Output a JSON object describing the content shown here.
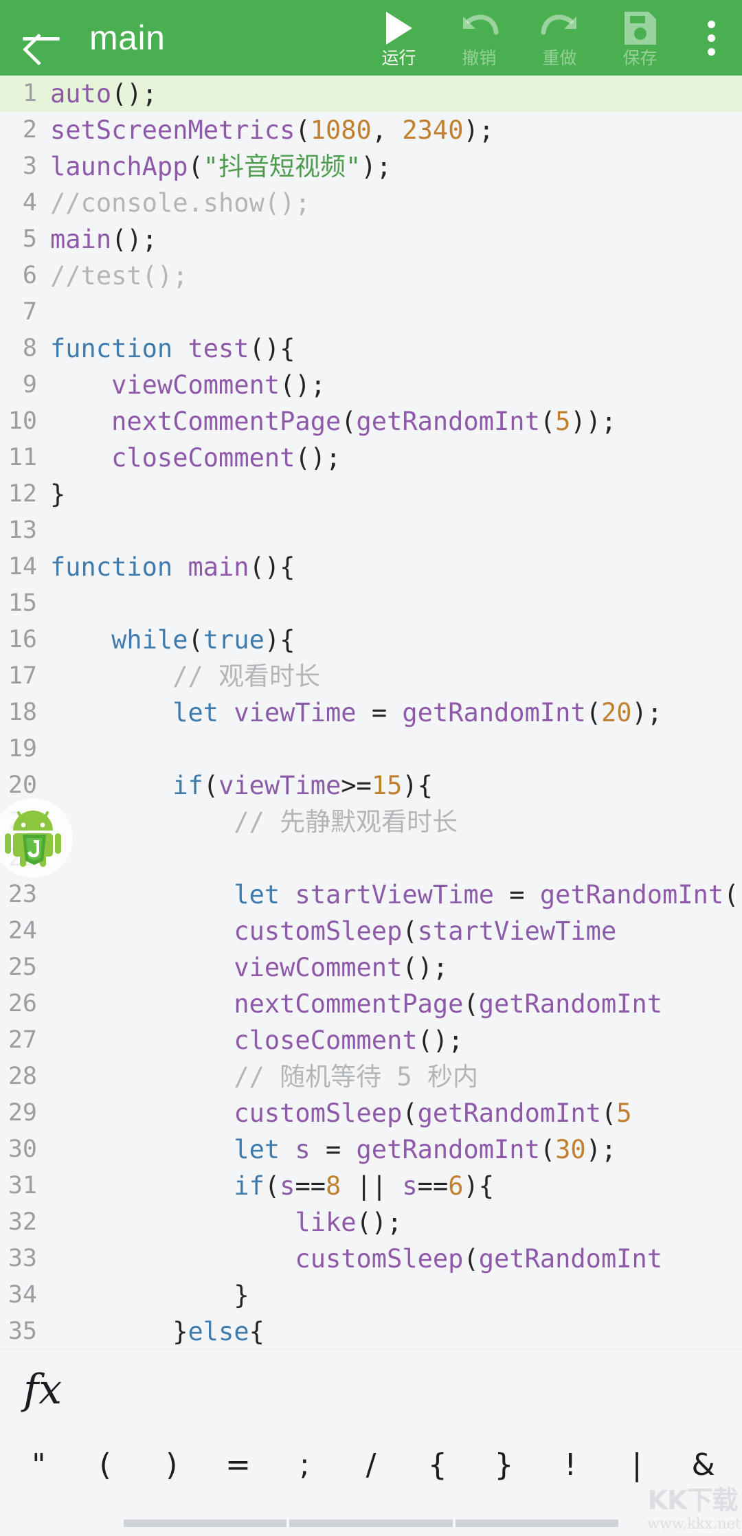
{
  "appbar": {
    "back_icon": "back-arrow-icon",
    "title": "main",
    "actions": [
      {
        "icon": "play-icon",
        "label": "运行",
        "enabled": true
      },
      {
        "icon": "undo-icon",
        "label": "撤销",
        "enabled": false
      },
      {
        "icon": "redo-icon",
        "label": "重做",
        "enabled": false
      },
      {
        "icon": "save-icon",
        "label": "保存",
        "enabled": false
      }
    ],
    "overflow_icon": "more-vertical-icon",
    "bar_color": "#4aaf50"
  },
  "editor": {
    "current_line": 1,
    "current_line_color": "#e6f4da",
    "background": "#f4f5f7",
    "lines": [
      {
        "n": 1,
        "tokens": [
          {
            "t": "auto",
            "c": "fn"
          },
          {
            "t": "();",
            "c": "pun"
          }
        ]
      },
      {
        "n": 2,
        "tokens": [
          {
            "t": "setScreenMetrics",
            "c": "fn"
          },
          {
            "t": "(",
            "c": "pun"
          },
          {
            "t": "1080",
            "c": "num"
          },
          {
            "t": ", ",
            "c": "pun"
          },
          {
            "t": "2340",
            "c": "num"
          },
          {
            "t": ");",
            "c": "pun"
          }
        ]
      },
      {
        "n": 3,
        "tokens": [
          {
            "t": "launchApp",
            "c": "fn"
          },
          {
            "t": "(",
            "c": "pun"
          },
          {
            "t": "\"抖音短视频\"",
            "c": "str"
          },
          {
            "t": ");",
            "c": "pun"
          }
        ]
      },
      {
        "n": 4,
        "tokens": [
          {
            "t": "//console.show();",
            "c": "cmt"
          }
        ]
      },
      {
        "n": 5,
        "tokens": [
          {
            "t": "main",
            "c": "fn"
          },
          {
            "t": "();",
            "c": "pun"
          }
        ]
      },
      {
        "n": 6,
        "tokens": [
          {
            "t": "//test();",
            "c": "cmt"
          }
        ]
      },
      {
        "n": 7,
        "tokens": []
      },
      {
        "n": 8,
        "tokens": [
          {
            "t": "function ",
            "c": "kw"
          },
          {
            "t": "test",
            "c": "fn"
          },
          {
            "t": "(){",
            "c": "pun"
          }
        ]
      },
      {
        "n": 9,
        "tokens": [
          {
            "t": "    ",
            "c": "pun"
          },
          {
            "t": "viewComment",
            "c": "fn"
          },
          {
            "t": "();",
            "c": "pun"
          }
        ]
      },
      {
        "n": 10,
        "tokens": [
          {
            "t": "    ",
            "c": "pun"
          },
          {
            "t": "nextCommentPage",
            "c": "fn"
          },
          {
            "t": "(",
            "c": "pun"
          },
          {
            "t": "getRandomInt",
            "c": "fn"
          },
          {
            "t": "(",
            "c": "pun"
          },
          {
            "t": "5",
            "c": "num"
          },
          {
            "t": "));",
            "c": "pun"
          }
        ]
      },
      {
        "n": 11,
        "tokens": [
          {
            "t": "    ",
            "c": "pun"
          },
          {
            "t": "closeComment",
            "c": "fn"
          },
          {
            "t": "();",
            "c": "pun"
          }
        ]
      },
      {
        "n": 12,
        "tokens": [
          {
            "t": "}",
            "c": "pun"
          }
        ]
      },
      {
        "n": 13,
        "tokens": []
      },
      {
        "n": 14,
        "tokens": [
          {
            "t": "function ",
            "c": "kw"
          },
          {
            "t": "main",
            "c": "fn"
          },
          {
            "t": "(){",
            "c": "pun"
          }
        ]
      },
      {
        "n": 15,
        "tokens": []
      },
      {
        "n": 16,
        "tokens": [
          {
            "t": "    ",
            "c": "pun"
          },
          {
            "t": "while",
            "c": "kw"
          },
          {
            "t": "(",
            "c": "pun"
          },
          {
            "t": "true",
            "c": "kw"
          },
          {
            "t": "){",
            "c": "pun"
          }
        ]
      },
      {
        "n": 17,
        "tokens": [
          {
            "t": "        ",
            "c": "pun"
          },
          {
            "t": "// 观看时长",
            "c": "cmt"
          }
        ]
      },
      {
        "n": 18,
        "tokens": [
          {
            "t": "        ",
            "c": "pun"
          },
          {
            "t": "let ",
            "c": "kw"
          },
          {
            "t": "viewTime",
            "c": "id"
          },
          {
            "t": " = ",
            "c": "pun"
          },
          {
            "t": "getRandomInt",
            "c": "fn"
          },
          {
            "t": "(",
            "c": "pun"
          },
          {
            "t": "20",
            "c": "num"
          },
          {
            "t": ");",
            "c": "pun"
          }
        ]
      },
      {
        "n": 19,
        "tokens": []
      },
      {
        "n": 20,
        "tokens": [
          {
            "t": "        ",
            "c": "pun"
          },
          {
            "t": "if",
            "c": "kw"
          },
          {
            "t": "(",
            "c": "pun"
          },
          {
            "t": "viewTime",
            "c": "id"
          },
          {
            "t": ">=",
            "c": "pun"
          },
          {
            "t": "15",
            "c": "num"
          },
          {
            "t": "){",
            "c": "pun"
          }
        ]
      },
      {
        "n": 21,
        "tokens": [
          {
            "t": "            ",
            "c": "pun"
          },
          {
            "t": "// 先静默观看时长",
            "c": "cmt"
          }
        ]
      },
      {
        "n": 22,
        "tokens": []
      },
      {
        "n": 23,
        "tokens": [
          {
            "t": "            ",
            "c": "pun"
          },
          {
            "t": "let ",
            "c": "kw"
          },
          {
            "t": "startViewTime",
            "c": "id"
          },
          {
            "t": " = ",
            "c": "pun"
          },
          {
            "t": "getRandomInt",
            "c": "fn"
          },
          {
            "t": "(",
            "c": "pun"
          }
        ]
      },
      {
        "n": 24,
        "tokens": [
          {
            "t": "            ",
            "c": "pun"
          },
          {
            "t": "customSleep",
            "c": "fn"
          },
          {
            "t": "(",
            "c": "pun"
          },
          {
            "t": "startViewTime",
            "c": "id"
          }
        ]
      },
      {
        "n": 25,
        "tokens": [
          {
            "t": "            ",
            "c": "pun"
          },
          {
            "t": "viewComment",
            "c": "fn"
          },
          {
            "t": "();",
            "c": "pun"
          }
        ]
      },
      {
        "n": 26,
        "tokens": [
          {
            "t": "            ",
            "c": "pun"
          },
          {
            "t": "nextCommentPage",
            "c": "fn"
          },
          {
            "t": "(",
            "c": "pun"
          },
          {
            "t": "getRandomInt",
            "c": "fn"
          }
        ]
      },
      {
        "n": 27,
        "tokens": [
          {
            "t": "            ",
            "c": "pun"
          },
          {
            "t": "closeComment",
            "c": "fn"
          },
          {
            "t": "();",
            "c": "pun"
          }
        ]
      },
      {
        "n": 28,
        "tokens": [
          {
            "t": "            ",
            "c": "pun"
          },
          {
            "t": "// 随机等待 5 秒内",
            "c": "cmt"
          }
        ]
      },
      {
        "n": 29,
        "tokens": [
          {
            "t": "            ",
            "c": "pun"
          },
          {
            "t": "customSleep",
            "c": "fn"
          },
          {
            "t": "(",
            "c": "pun"
          },
          {
            "t": "getRandomInt",
            "c": "fn"
          },
          {
            "t": "(",
            "c": "pun"
          },
          {
            "t": "5",
            "c": "num"
          }
        ]
      },
      {
        "n": 30,
        "tokens": [
          {
            "t": "            ",
            "c": "pun"
          },
          {
            "t": "let ",
            "c": "kw"
          },
          {
            "t": "s",
            "c": "id"
          },
          {
            "t": " = ",
            "c": "pun"
          },
          {
            "t": "getRandomInt",
            "c": "fn"
          },
          {
            "t": "(",
            "c": "pun"
          },
          {
            "t": "30",
            "c": "num"
          },
          {
            "t": ");",
            "c": "pun"
          }
        ]
      },
      {
        "n": 31,
        "tokens": [
          {
            "t": "            ",
            "c": "pun"
          },
          {
            "t": "if",
            "c": "kw"
          },
          {
            "t": "(",
            "c": "pun"
          },
          {
            "t": "s",
            "c": "id"
          },
          {
            "t": "==",
            "c": "pun"
          },
          {
            "t": "8",
            "c": "num"
          },
          {
            "t": " || ",
            "c": "pun"
          },
          {
            "t": "s",
            "c": "id"
          },
          {
            "t": "==",
            "c": "pun"
          },
          {
            "t": "6",
            "c": "num"
          },
          {
            "t": "){",
            "c": "pun"
          }
        ]
      },
      {
        "n": 32,
        "tokens": [
          {
            "t": "                ",
            "c": "pun"
          },
          {
            "t": "like",
            "c": "fn"
          },
          {
            "t": "();",
            "c": "pun"
          }
        ]
      },
      {
        "n": 33,
        "tokens": [
          {
            "t": "                ",
            "c": "pun"
          },
          {
            "t": "customSleep",
            "c": "fn"
          },
          {
            "t": "(",
            "c": "pun"
          },
          {
            "t": "getRandomInt",
            "c": "fn"
          }
        ]
      },
      {
        "n": 34,
        "tokens": [
          {
            "t": "            ",
            "c": "pun"
          },
          {
            "t": "}",
            "c": "pun"
          }
        ]
      },
      {
        "n": 35,
        "tokens": [
          {
            "t": "        ",
            "c": "pun"
          },
          {
            "t": "}",
            "c": "pun"
          },
          {
            "t": "else",
            "c": "kw"
          },
          {
            "t": "{",
            "c": "pun"
          }
        ]
      }
    ],
    "floating_bubble_icon": "autojs-android-robot-icon"
  },
  "bottom": {
    "fx_label": "fx",
    "symbols": [
      "\"",
      "(",
      ")",
      "=",
      ";",
      "/",
      "{",
      "}",
      "!",
      "|",
      "&"
    ],
    "scrollbar_segments": 3
  },
  "watermark": {
    "logo": "KK下载",
    "url": "www.kkx.net"
  }
}
